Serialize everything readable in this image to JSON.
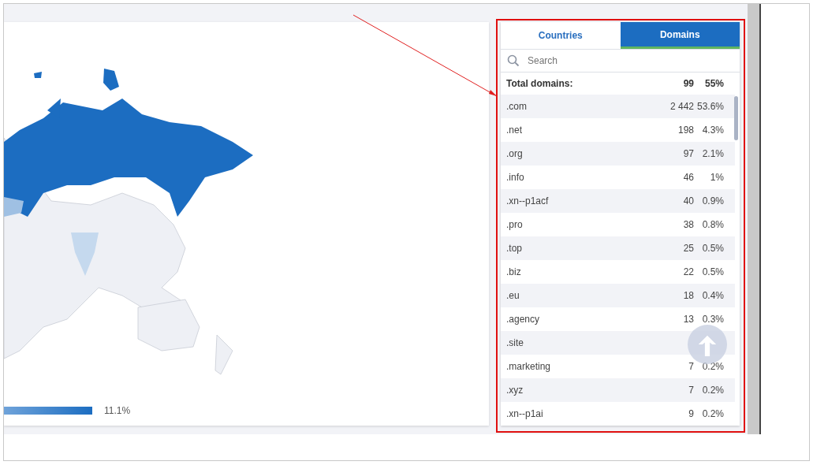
{
  "map": {
    "legend": {
      "label": "11.1%"
    }
  },
  "panel": {
    "tabs": [
      {
        "label": "Countries",
        "selected": false
      },
      {
        "label": "Domains",
        "selected": true
      }
    ],
    "search": {
      "placeholder": "Search"
    },
    "total": {
      "label": "Total domains:",
      "count": "99",
      "share": "55%"
    },
    "rows": [
      {
        "name": ".com",
        "count": "2 442",
        "share": "53.6%"
      },
      {
        "name": ".net",
        "count": "198",
        "share": "4.3%"
      },
      {
        "name": ".org",
        "count": "97",
        "share": "2.1%"
      },
      {
        "name": ".info",
        "count": "46",
        "share": "1%"
      },
      {
        "name": ".xn--p1acf",
        "count": "40",
        "share": "0.9%"
      },
      {
        "name": ".pro",
        "count": "38",
        "share": "0.8%"
      },
      {
        "name": ".top",
        "count": "25",
        "share": "0.5%"
      },
      {
        "name": ".biz",
        "count": "22",
        "share": "0.5%"
      },
      {
        "name": ".eu",
        "count": "18",
        "share": "0.4%"
      },
      {
        "name": ".agency",
        "count": "13",
        "share": "0.3%"
      },
      {
        "name": ".site"
      },
      {
        "name": ".marketing",
        "count": "7",
        "share": "0.2%"
      },
      {
        "name": ".xyz",
        "count": "7",
        "share": "0.2%"
      },
      {
        "name": ".xn--p1ai",
        "count": "9",
        "share": "0.2%"
      }
    ]
  }
}
